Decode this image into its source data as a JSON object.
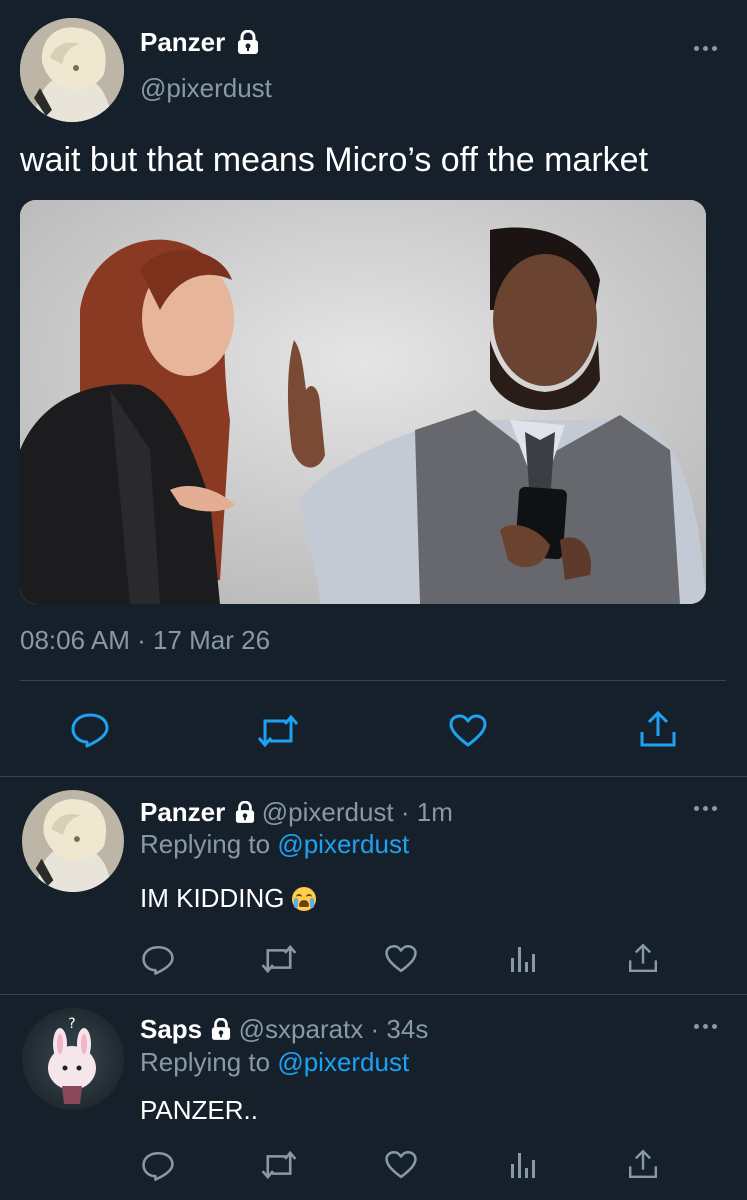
{
  "main_tweet": {
    "display_name": "Panzer",
    "handle": "@pixerdust",
    "text": "wait but that means Micro’s off the market",
    "time": "08:06 AM",
    "separator": "·",
    "date": "17 Mar 26",
    "actions": [
      "reply-icon",
      "retweet-icon",
      "like-icon",
      "share-icon"
    ]
  },
  "replies": [
    {
      "display_name": "Panzer",
      "handle": "@pixerdust",
      "dot": "·",
      "age": "1m",
      "replying_prefix": "Replying to",
      "replying_to": "@pixerdust",
      "text": "IM KIDDING",
      "emoji": "loudly-crying-face"
    },
    {
      "display_name": "Saps",
      "handle": "@sxparatx",
      "dot": "·",
      "age": "34s",
      "replying_prefix": "Replying to",
      "replying_to": "@pixerdust",
      "text": "PANZER.."
    }
  ],
  "colors": {
    "background": "#15202b",
    "muted": "#8899a6",
    "link": "#1da1f2",
    "divider": "#38444d"
  }
}
